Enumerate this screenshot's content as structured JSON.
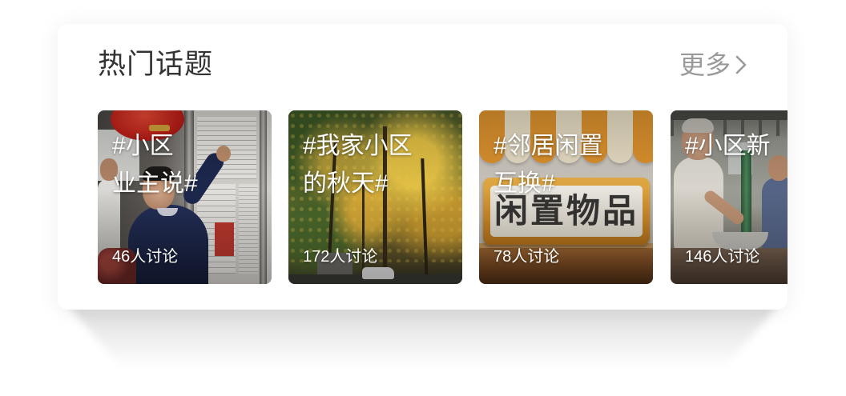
{
  "theme": {
    "title_color": "#333333",
    "more_color": "#999999",
    "card_background": "#ffffff"
  },
  "section": {
    "title": "热门话题",
    "more_label": "更多",
    "more_icon": "chevron-right-icon"
  },
  "topics": [
    {
      "title_lines": [
        "#小区",
        "业主说#"
      ],
      "discussion": "46人讨论"
    },
    {
      "title_lines": [
        "#我家小区",
        "的秋天#"
      ],
      "discussion": "172人讨论"
    },
    {
      "title_lines": [
        "#邻居闲置",
        "互换#"
      ],
      "discussion": "78人讨论",
      "cover_sign_text": "闲置物品"
    },
    {
      "title_lines": [
        "#小区新"
      ],
      "discussion": "146人讨论"
    }
  ]
}
